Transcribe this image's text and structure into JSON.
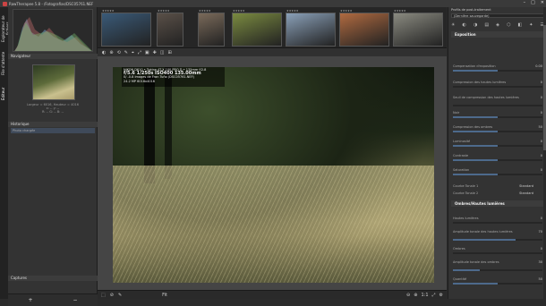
{
  "titlebar": {
    "title": "RawTherapee 5.8 - /Fotografias/DSC05761.NEF",
    "winbtns": [
      "–",
      "□",
      "✕"
    ]
  },
  "vtabs": [
    "Explorateur de fichiers",
    "File d'attente",
    "Éditeur"
  ],
  "left": {
    "navigator_label": "Navigateur",
    "nav_meta": [
      "Largeur = 6016, Hauteur = 4016",
      "x: --  y: --",
      "R: --  G: --  B: --"
    ],
    "history_label": "Historique",
    "history_items": [
      {
        "name": "Photo chargée",
        "value": ""
      }
    ],
    "snapshots_label": "Captures",
    "bottom_buttons": [
      "+",
      "−"
    ]
  },
  "filmstrip": {
    "thumbs": [
      {
        "label": "★★★★★",
        "color": "#3a5a78"
      },
      {
        "label": "★★★★★",
        "color": "#5a5048"
      },
      {
        "label": "★★★★★",
        "color": "#7a6a5a"
      },
      {
        "label": "★★★★★",
        "color": "#7a8a40"
      },
      {
        "label": "★★★★★",
        "color": "#8aa0b8"
      },
      {
        "label": "★★★★★",
        "color": "#b06a40"
      },
      {
        "label": "★★★★★",
        "color": "#8a8a80"
      }
    ]
  },
  "overlay": {
    "camera": "NIKON D610 • Tokina AT-X 100 PRO D • 135mm f/2.8",
    "exposure": "f/5.6  1/250s  ISO400  135.00mm",
    "line3": "0/ -0.8 Images de Fran Tuño (DSC05761.NEF)",
    "line4": "24.2 MP  6016x4016"
  },
  "toolbar": {
    "icons": [
      "◐",
      "⊕",
      "⟲",
      "✎",
      "⌖",
      "⤢",
      "▣",
      "✚",
      "◫",
      "⊞"
    ]
  },
  "statusbar": {
    "left": [
      "⬚",
      "⊘",
      "✎"
    ],
    "zoom": "Fit",
    "right": [
      "⊖",
      "⊕",
      "1:1",
      "⤢",
      "⚙"
    ]
  },
  "right": {
    "top_label": "Profils de post-traitement",
    "profile": "(Dernière sauvegarde)",
    "tool_icons": [
      "☀",
      "◐",
      "◑",
      "▤",
      "◈",
      "⬡",
      "◧",
      "✦",
      "☰"
    ],
    "sections": [
      {
        "title": "Exposition",
        "rows": [
          {
            "label": "Compensation d'exposition",
            "value": "0.00",
            "fill": 0.5
          },
          {
            "label": "Compression des hautes lumières",
            "value": "0",
            "fill": 0.0
          },
          {
            "label": "Seuil de compression des hautes lumières",
            "value": "0",
            "fill": 0.0
          },
          {
            "label": "Noir",
            "value": "0",
            "fill": 0.5
          },
          {
            "label": "Compression des ombres",
            "value": "50",
            "fill": 0.5
          },
          {
            "label": "Luminosité",
            "value": "0",
            "fill": 0.5
          },
          {
            "label": "Contraste",
            "value": "0",
            "fill": 0.5
          },
          {
            "label": "Saturation",
            "value": "0",
            "fill": 0.5
          }
        ],
        "curve1": "Courbe Tonale 1",
        "curve2": "Courbe Tonale 2",
        "curve_mode": "Standard"
      },
      {
        "title": "Ombres/Hautes lumières",
        "rows": [
          {
            "label": "Hautes lumières",
            "value": "0",
            "fill": 0.0
          },
          {
            "label": "Amplitude tonale des hautes lumières",
            "value": "70",
            "fill": 0.7
          },
          {
            "label": "Ombres",
            "value": "0",
            "fill": 0.0
          },
          {
            "label": "Amplitude tonale des ombres",
            "value": "30",
            "fill": 0.3
          },
          {
            "label": "Quantité",
            "value": "50",
            "fill": 0.5
          }
        ]
      }
    ]
  }
}
